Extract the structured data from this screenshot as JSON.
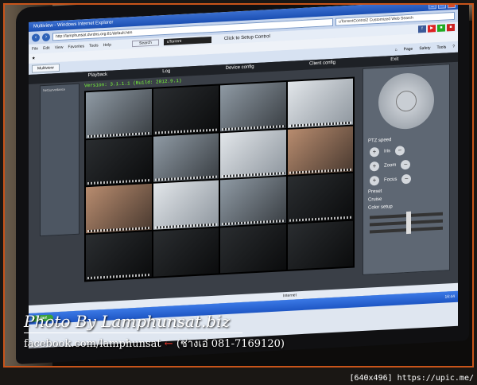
{
  "browser": {
    "title": "Multiview - Windows Internet Explorer",
    "url": "http://lamphunsat.dvrdns.org:81/default.htm",
    "search_placeholder": "uTorrentControl2 Customized Web Search",
    "menu": [
      "File",
      "Edit",
      "View",
      "Favorites",
      "Tools",
      "Help"
    ],
    "toolbar_search": "Search",
    "utorrent_label": "uTorrent",
    "setup_label": "Click to Setup Control",
    "tab_label": "Multiview",
    "tab_tools": [
      "Page",
      "Safety",
      "Tools"
    ]
  },
  "app": {
    "menu": [
      "Playback",
      "Log",
      "Device config",
      "Client config",
      "Exit"
    ],
    "version": "Version: 3.1.1.1 (Build: 2012.9.1)",
    "sidebar_label": "NetSurveillance",
    "ptz": {
      "speed_label": "PTZ speed",
      "zoom_label": "Zoom",
      "focus_label": "Focus",
      "iris_label": "Iris",
      "preset_label": "Preset",
      "cruise_label": "Cruise",
      "color_label": "Color setup"
    }
  },
  "statusbar": {
    "zone": "Internet"
  },
  "taskbar": {
    "start": "start",
    "clock": "16:44"
  },
  "watermark": {
    "title": "Photo By Lamphunsat.biz",
    "facebook": "facebook.com/lamphunsat",
    "phone": "(ช่างเอ๋ 081-7169120)"
  },
  "upic": "[640x496] https://upic.me/"
}
